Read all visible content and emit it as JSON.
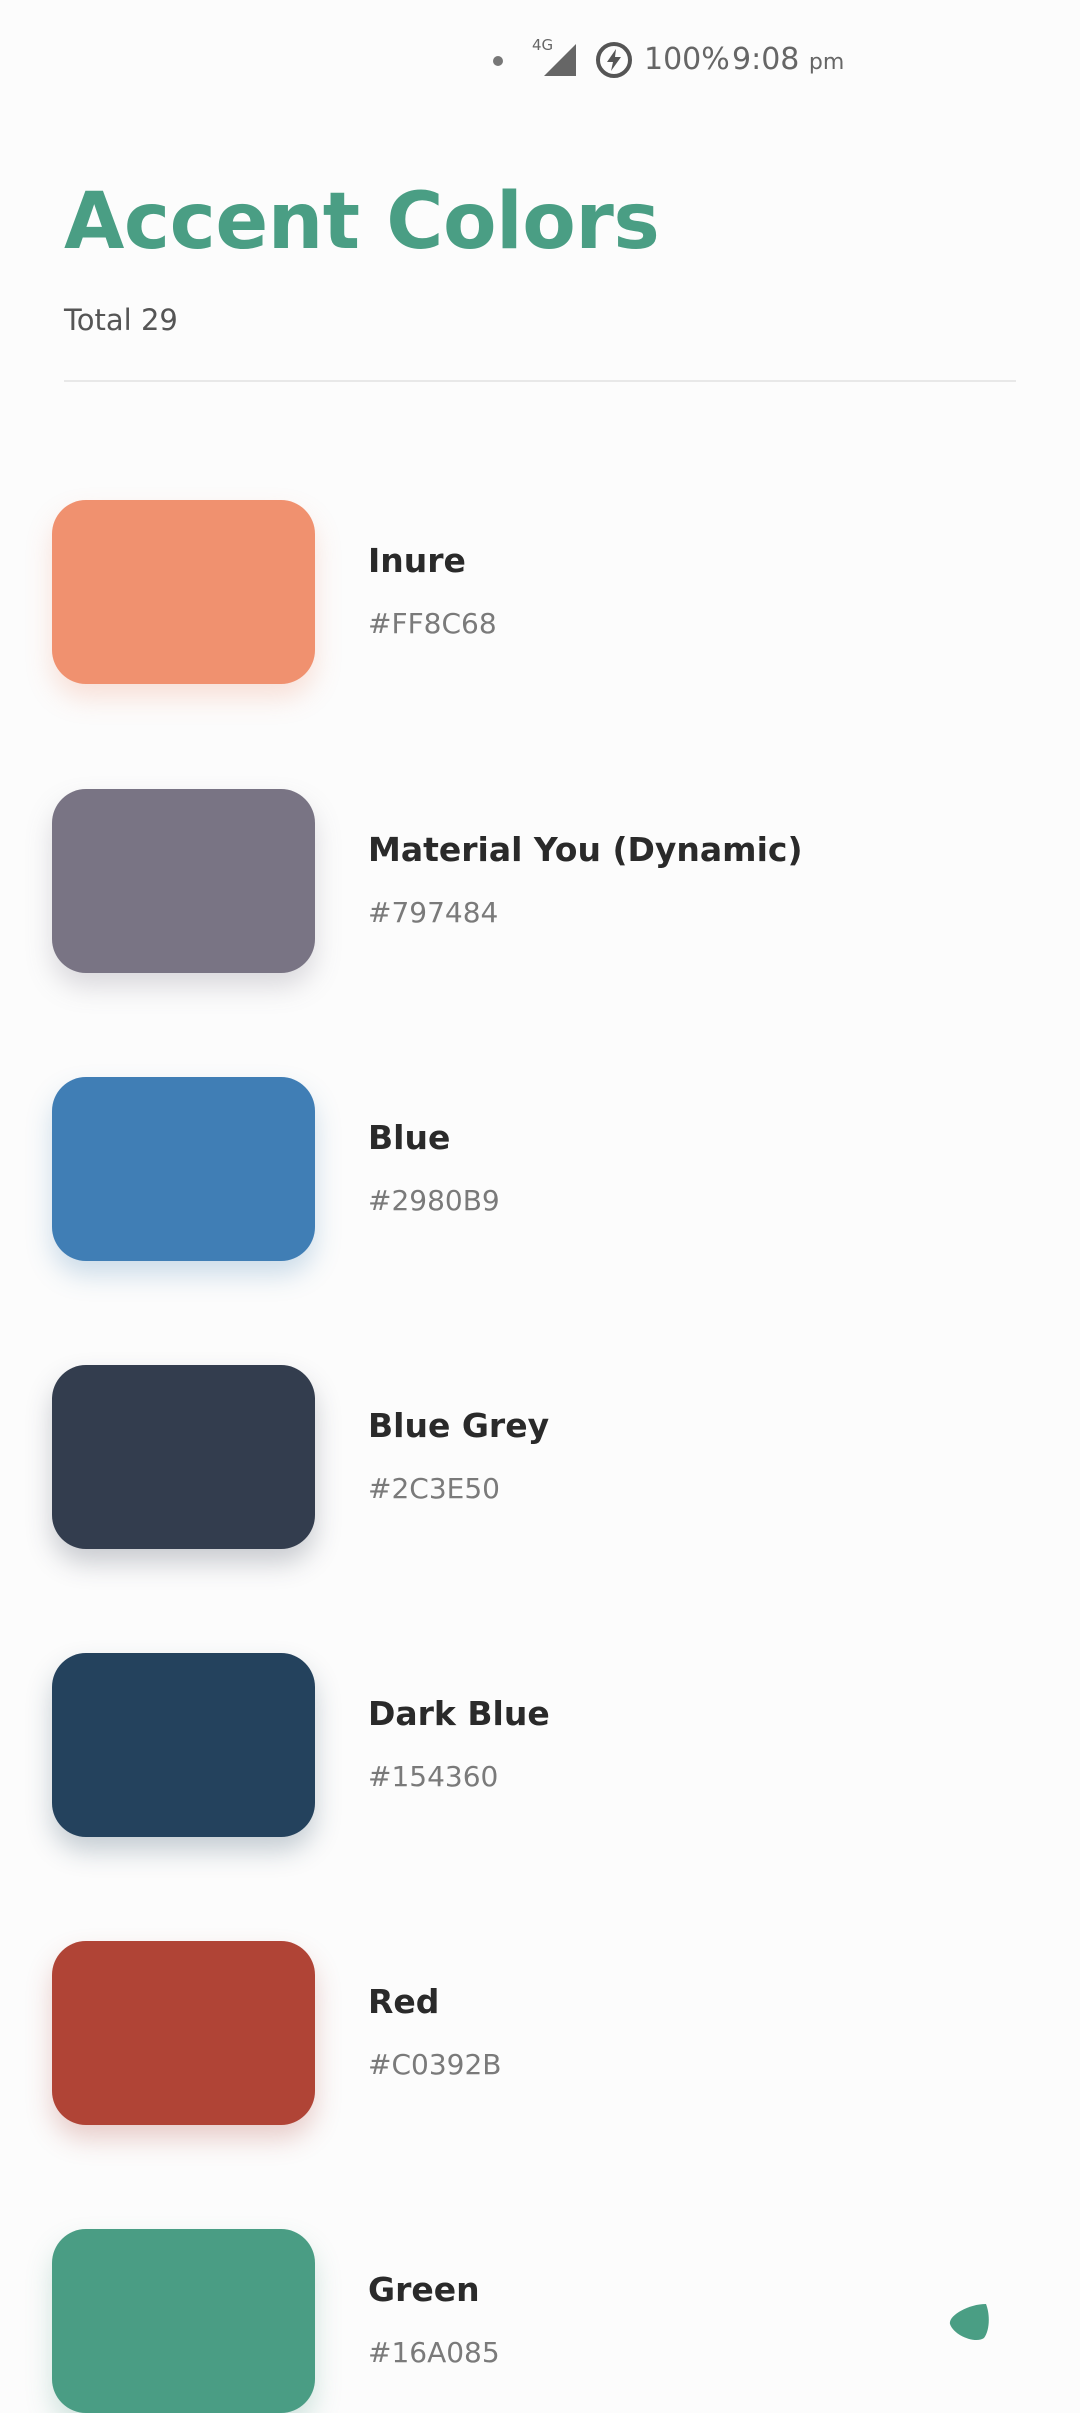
{
  "status_bar": {
    "network": "4G",
    "battery": "100%",
    "time": "9:08",
    "ampm": "pm"
  },
  "header": {
    "title": "Accent Colors",
    "total": "Total 29"
  },
  "colors": [
    {
      "name": "Inure",
      "hex": "#FF8C68",
      "swatch": "#F0916F"
    },
    {
      "name": "Material You (Dynamic)",
      "hex": "#797484",
      "swatch": "#797484"
    },
    {
      "name": "Blue",
      "hex": "#2980B9",
      "swatch": "#407EB5"
    },
    {
      "name": "Blue Grey",
      "hex": "#2C3E50",
      "swatch": "#333D4E"
    },
    {
      "name": "Dark Blue",
      "hex": "#154360",
      "swatch": "#24425D"
    },
    {
      "name": "Red",
      "hex": "#C0392B",
      "swatch": "#B04436"
    },
    {
      "name": "Green",
      "hex": "#16A085",
      "swatch": "#4A9D84"
    }
  ],
  "theme": {
    "accent": "#4A9E84"
  }
}
